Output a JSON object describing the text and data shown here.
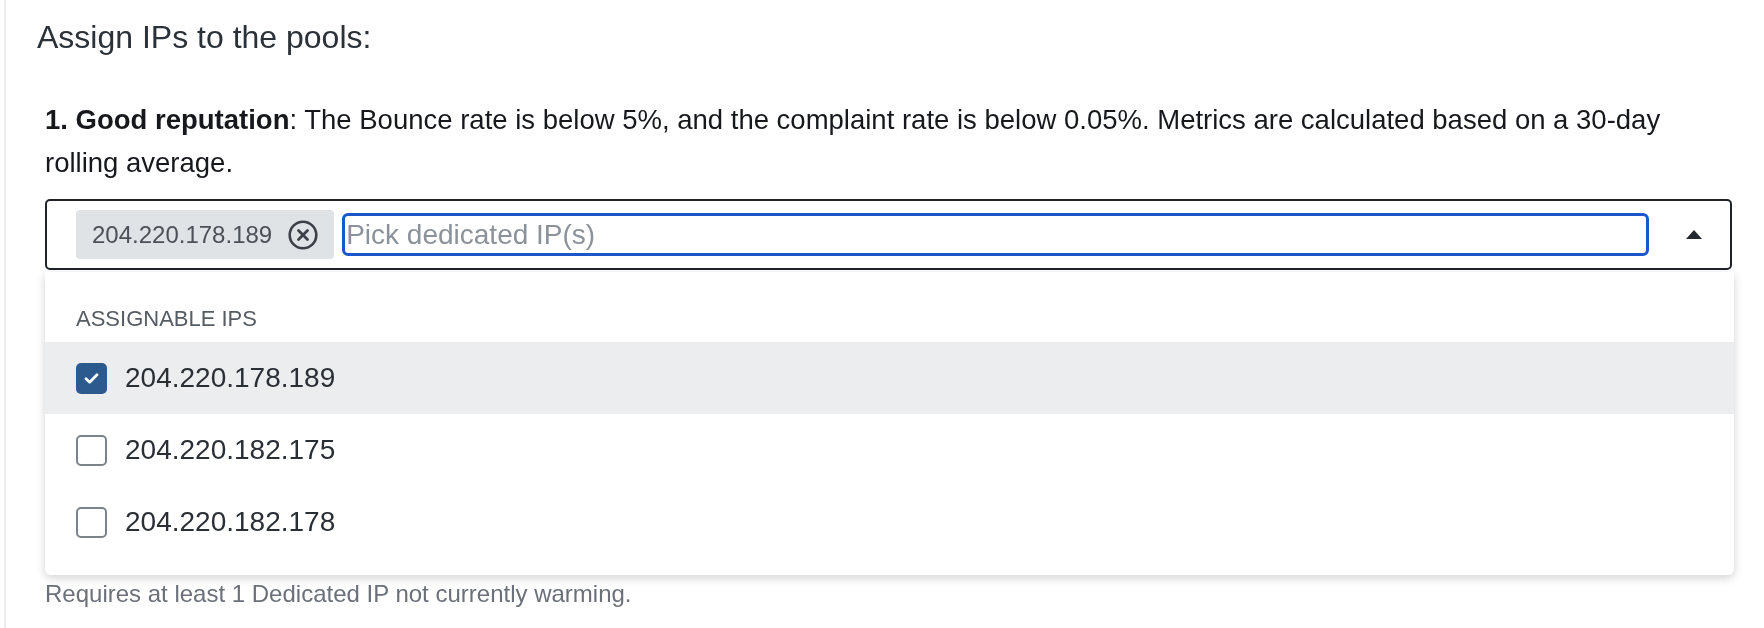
{
  "heading": "Assign IPs to the pools:",
  "description": "**1. Good reputation**: The Bounce rate is below 5%, and the complaint rate is below 0.05%. Metrics are calculated based on a 30-day rolling average.",
  "ip_picker": {
    "expanded": true,
    "tags": [
      {
        "label": "204.220.178.189"
      }
    ],
    "search": {
      "placeholder": "Pick dedicated IP(s)",
      "focused": true
    },
    "menu": {
      "heading": "ASSIGNABLE IPS",
      "options": [
        {
          "label": "204.220.178.189",
          "checked": true,
          "selected": true
        },
        {
          "label": "204.220.182.175",
          "checked": false,
          "selected": false
        },
        {
          "label": "204.220.182.178",
          "checked": false,
          "selected": false
        }
      ]
    }
  },
  "hint": "Requires at least 1 Dedicated IP not currently warming."
}
